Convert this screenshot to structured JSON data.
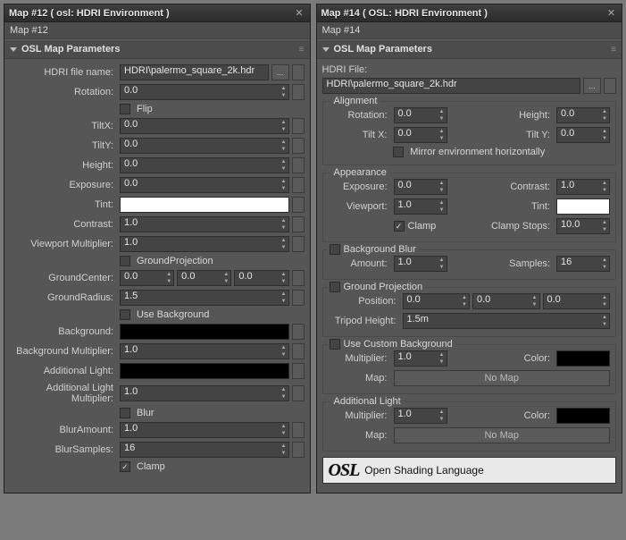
{
  "left": {
    "title": "Map #12  ( osl: HDRI Environment )",
    "subtitle": "Map #12",
    "section": "OSL Map Parameters",
    "hdri_file_label": "HDRI file name:",
    "hdri_file": "HDRI\\palermo_square_2k.hdr",
    "rotation_label": "Rotation:",
    "rotation": "0.0",
    "flip_label": "Flip",
    "tiltx_label": "TiltX:",
    "tiltx": "0.0",
    "tilty_label": "TiltY:",
    "tilty": "0.0",
    "height_label": "Height:",
    "height": "0.0",
    "exposure_label": "Exposure:",
    "exposure": "0.0",
    "tint_label": "Tint:",
    "contrast_label": "Contrast:",
    "contrast": "1.0",
    "viewport_label": "Viewport Multiplier:",
    "viewport": "1.0",
    "groundproj_label": "GroundProjection",
    "groundcenter_label": "GroundCenter:",
    "groundcenter_x": "0.0",
    "groundcenter_y": "0.0",
    "groundcenter_z": "0.0",
    "groundradius_label": "GroundRadius:",
    "groundradius": "1.5",
    "usebg_label": "Use Background",
    "background_label": "Background:",
    "bgmult_label": "Background Multiplier:",
    "bgmult": "1.0",
    "addlight_label": "Additional Light:",
    "addlightmult_label": "Additional Light Multiplier:",
    "addlightmult": "1.0",
    "blur_label": "Blur",
    "bluramount_label": "BlurAmount:",
    "bluramount": "1.0",
    "blursamples_label": "BlurSamples:",
    "blursamples": "16",
    "clamp_label": "Clamp"
  },
  "right": {
    "title": "Map #14  ( OSL: HDRI Environment )",
    "subtitle": "Map #14",
    "section": "OSL Map Parameters",
    "hdri_file_label": "HDRI File:",
    "hdri_file": "HDRI\\palermo_square_2k.hdr",
    "align_label": "Alignment",
    "rotation_label": "Rotation:",
    "rotation": "0.0",
    "height_label": "Height:",
    "height": "0.0",
    "tiltx_label": "Tilt X:",
    "tiltx": "0.0",
    "tilty_label": "Tilt Y:",
    "tilty": "0.0",
    "mirror_label": "Mirror environment horizontally",
    "appearance_label": "Appearance",
    "exposure_label": "Exposure:",
    "exposure": "0.0",
    "contrast_label": "Contrast:",
    "contrast": "1.0",
    "viewport_label": "Viewport:",
    "viewport": "1.0",
    "tint_label": "Tint:",
    "clamp_label": "Clamp",
    "clampstops_label": "Clamp Stops:",
    "clampstops": "10.0",
    "bgblur_label": "Background Blur",
    "amount_label": "Amount:",
    "amount": "1.0",
    "samples_label": "Samples:",
    "samples": "16",
    "groundproj_label": "Ground Projection",
    "position_label": "Position:",
    "pos_x": "0.0",
    "pos_y": "0.0",
    "pos_z": "0.0",
    "tripod_label": "Tripod Height:",
    "tripod": "1.5m",
    "custombg_label": "Use Custom Background",
    "multiplier_label": "Multiplier:",
    "custombg_mult": "1.0",
    "color_label": "Color:",
    "map_label": "Map:",
    "nomap": "No Map",
    "addlight_label": "Additional Light",
    "addlight_mult": "1.0",
    "osl_logo": "OSL",
    "osl_text": "Open Shading Language"
  }
}
